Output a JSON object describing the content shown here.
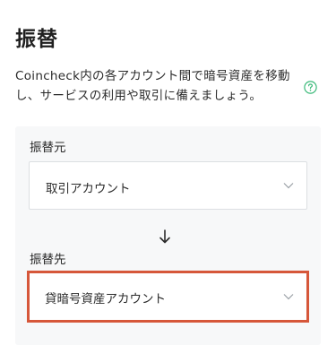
{
  "page": {
    "title": "振替",
    "description": "Coincheck内の各アカウント間で暗号資産を移動し、サービスの利用や取引に備えましょう。"
  },
  "transfer": {
    "from_label": "振替元",
    "from_value": "取引アカウント",
    "to_label": "振替先",
    "to_value": "貸暗号資産アカウント"
  },
  "colors": {
    "highlight": "#d6573a",
    "help_icon": "#3cba7a"
  },
  "icons": {
    "help": "question-circle-icon",
    "arrow": "arrow-down-icon",
    "chevron": "chevron-down-icon"
  }
}
